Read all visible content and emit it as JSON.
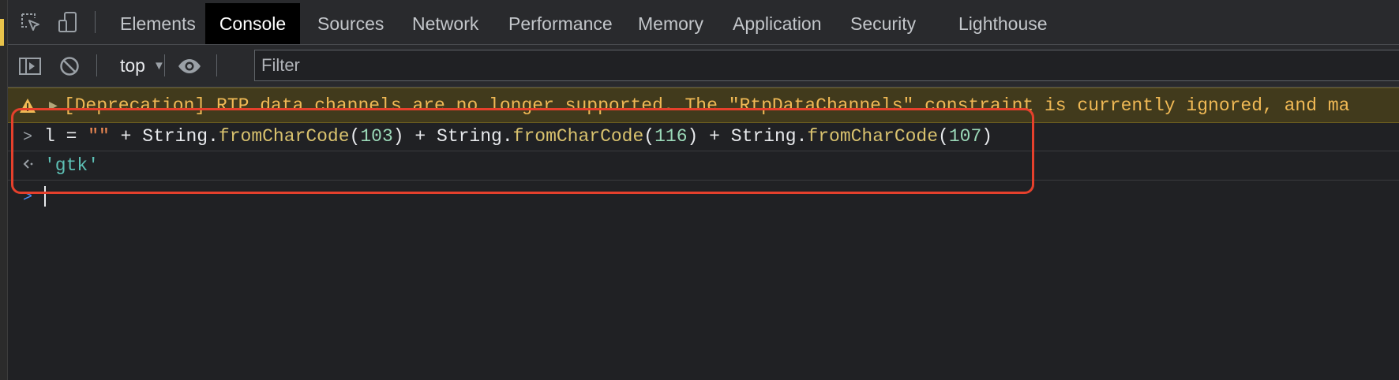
{
  "tabs": [
    {
      "label": "Elements",
      "active": false
    },
    {
      "label": "Console",
      "active": true
    },
    {
      "label": "Sources",
      "active": false
    },
    {
      "label": "Network",
      "active": false
    },
    {
      "label": "Performance",
      "active": false
    },
    {
      "label": "Memory",
      "active": false
    },
    {
      "label": "Application",
      "active": false
    },
    {
      "label": "Security",
      "active": false
    },
    {
      "label": "Lighthouse",
      "active": false
    }
  ],
  "toolbar": {
    "icons": [
      "inspect-element-icon",
      "device-toolbar-icon"
    ]
  },
  "filterbar": {
    "context": "top",
    "filter_placeholder": "Filter",
    "icons": [
      "sidebar-toggle-icon",
      "clear-console-icon",
      "live-expression-eye-icon"
    ]
  },
  "console": {
    "warning": {
      "icon": "warning-icon",
      "text": "[Deprecation] RTP data channels are no longer supported. The \"RtpDataChannels\" constraint is currently ignored, and ma"
    },
    "input": {
      "var": "l",
      "eq": " = ",
      "empty_str": "\"\"",
      "plus": " + ",
      "obj": "String",
      "dot": ".",
      "fn": "fromCharCode",
      "lparen": "(",
      "rparen": ")",
      "codes": [
        "103",
        "116",
        "107"
      ]
    },
    "result": "'gtk'"
  },
  "colors": {
    "background": "#202124",
    "warning_text": "#f0b955",
    "highlight_box": "#e5402c",
    "prompt_active": "#4e8ef7"
  }
}
